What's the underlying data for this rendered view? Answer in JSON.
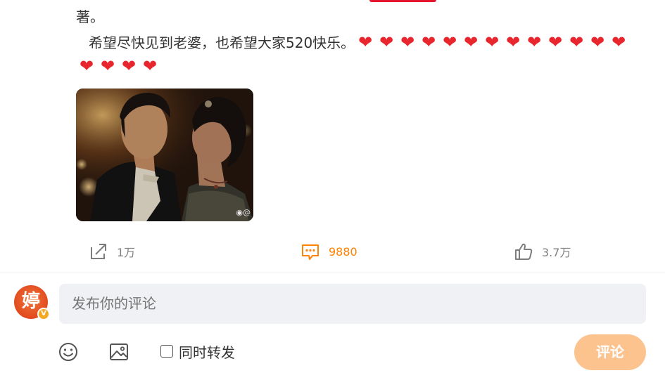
{
  "post": {
    "text_line_1": "著。",
    "text_line_2": "希望尽快见到老婆，也希望大家520快乐。",
    "hearts_line_2": [
      "❤",
      "❤",
      "❤",
      "❤",
      "❤",
      "❤",
      "❤",
      "❤",
      "❤",
      "❤",
      "❤",
      "❤",
      "❤"
    ],
    "hearts_line_3": [
      "❤",
      "❤",
      "❤",
      "❤"
    ],
    "image_watermark": "@"
  },
  "actions": {
    "share_count": "1万",
    "comment_count": "9880",
    "like_count": "3.7万"
  },
  "composer": {
    "avatar_text": "婷",
    "badge_text": "V",
    "placeholder": "发布你的评论",
    "repost_label": "同时转发",
    "submit_label": "评论"
  },
  "colors": {
    "accent_orange": "#ff8200",
    "heart_red": "#e8262d",
    "submit_disabled": "#fcc38f",
    "input_bg": "#f0f1f4"
  },
  "icons": {
    "share": "share-icon",
    "comment": "comment-icon",
    "like": "thumbs-up-icon",
    "emoji": "emoji-icon",
    "image": "image-icon"
  }
}
